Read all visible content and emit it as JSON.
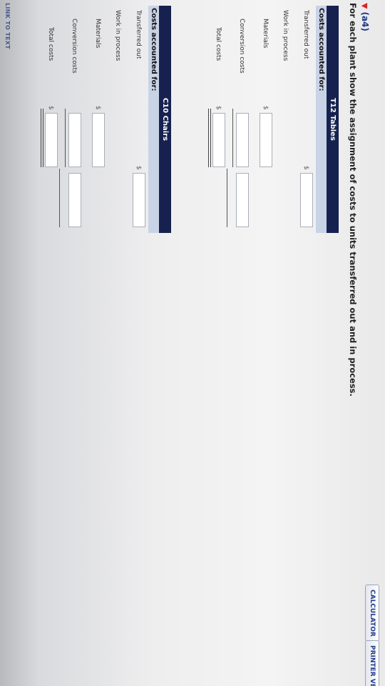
{
  "toolbar": {
    "calculator_label": "CALCULATOR",
    "printer_label": "PRINTER VERS"
  },
  "question": {
    "number": "(a4)",
    "instruction": "For each plant show the assignment of costs to units transferred out and in process."
  },
  "tables": [
    {
      "title": "T12 Tables",
      "subheader": "Costs accounted for:",
      "rows": {
        "transferred_out": "Transferred out",
        "work_in_process": "Work in process",
        "materials": "Materials",
        "conversion_costs": "Conversion costs",
        "total_costs": "Total costs"
      },
      "currency": "$",
      "values": {
        "transferred_out": "",
        "materials": "",
        "conversion_costs": "",
        "wip_total": "",
        "total_costs": ""
      }
    },
    {
      "title": "C10 Chairs",
      "subheader": "Costs accounted for:",
      "rows": {
        "transferred_out": "Transferred out",
        "work_in_process": "Work in process",
        "materials": "Materials",
        "conversion_costs": "Conversion costs",
        "total_costs": "Total costs"
      },
      "currency": "$",
      "values": {
        "transferred_out": "",
        "materials": "",
        "conversion_costs": "",
        "wip_total": "",
        "total_costs": ""
      }
    }
  ],
  "footer": {
    "link_label": "LINK TO TEXT"
  }
}
